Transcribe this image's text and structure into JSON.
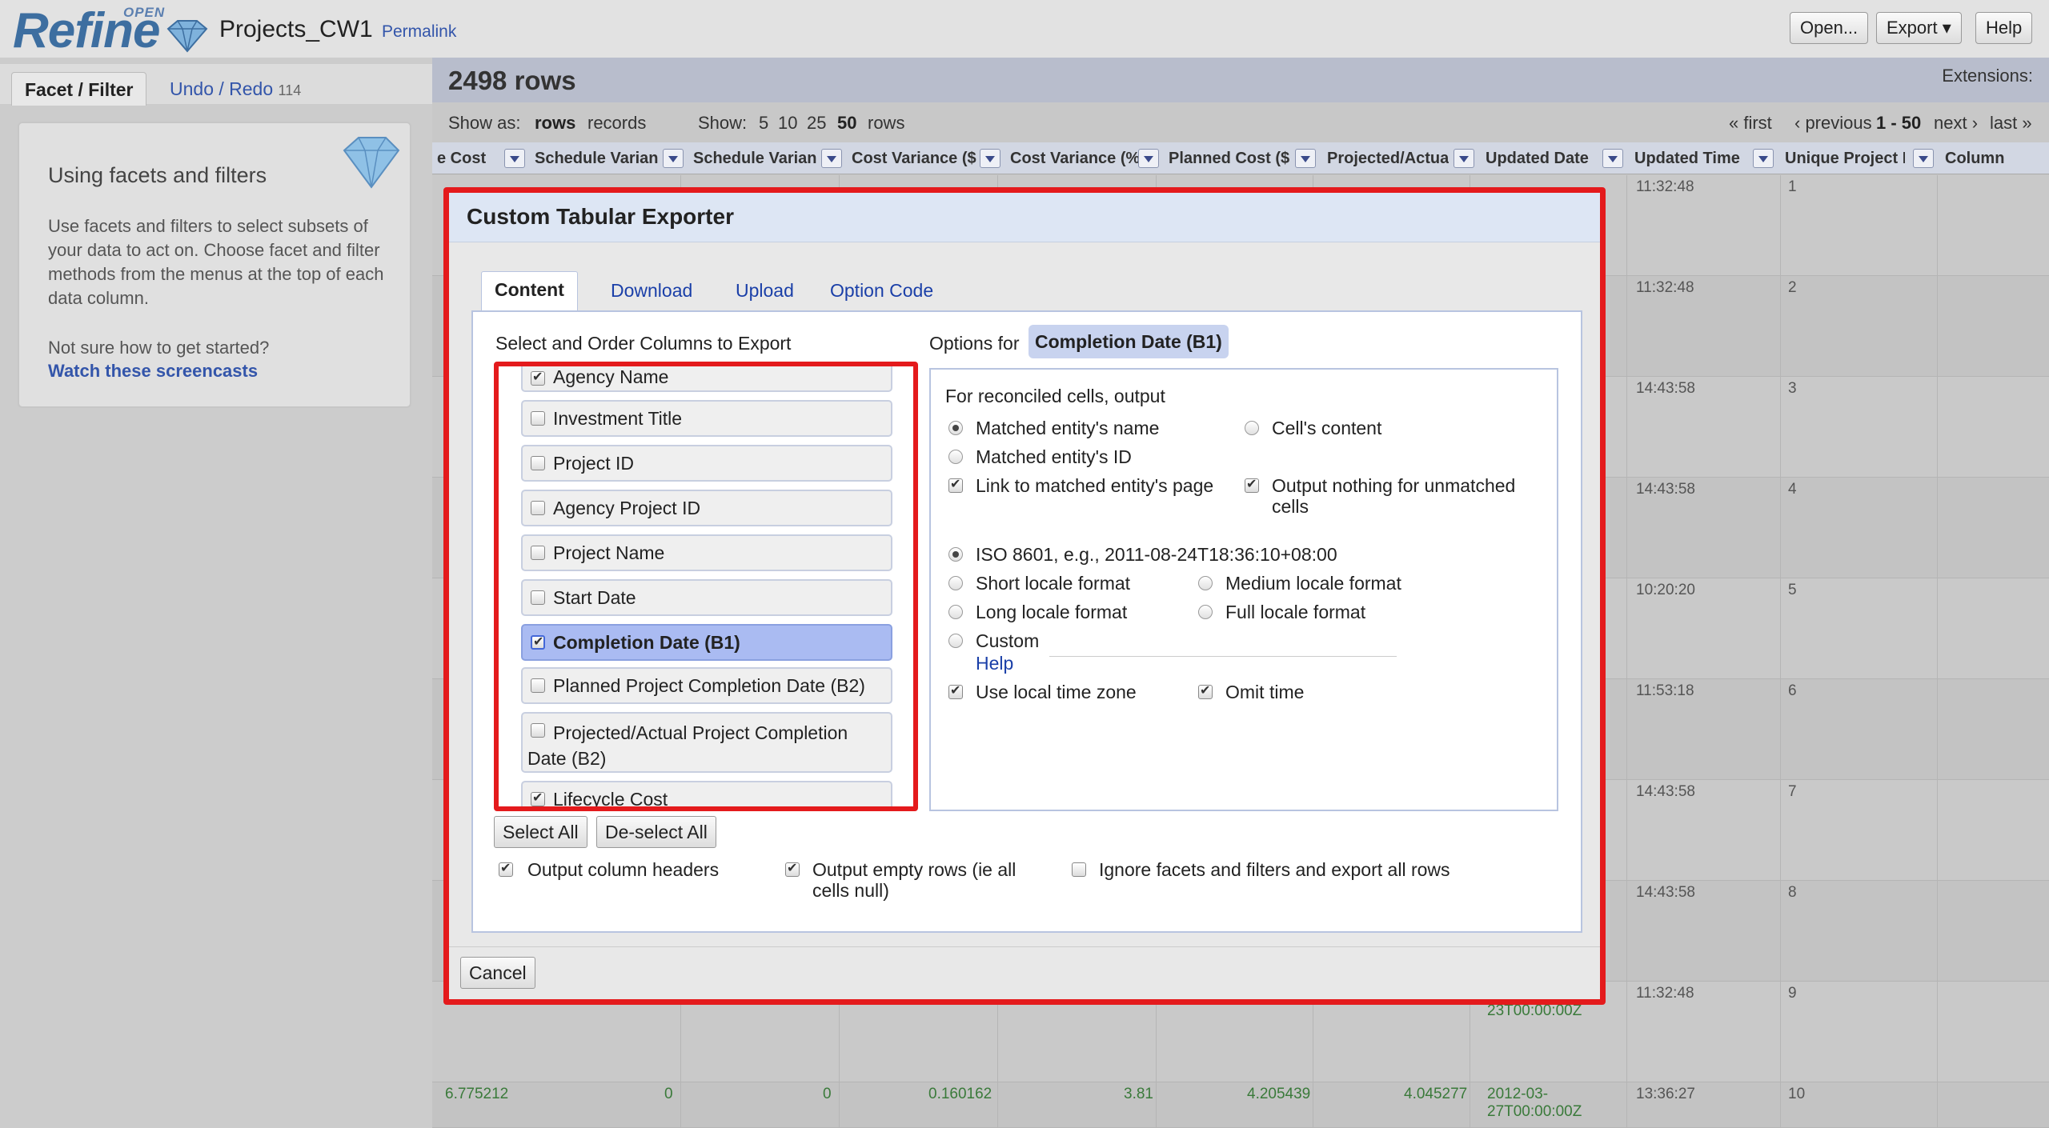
{
  "header": {
    "logo_open": "OPEN",
    "logo_refine": "Refine",
    "project_name": "Projects_CW1",
    "permalink": "Permalink",
    "buttons": {
      "open": "Open...",
      "export": "Export ▾",
      "help": "Help"
    }
  },
  "left": {
    "tabs": {
      "facet": "Facet / Filter",
      "undo": "Undo / Redo",
      "undo_count": "114"
    },
    "help": {
      "title": "Using facets and filters",
      "text": "Use facets and filters to select subsets of your data to act on. Choose facet and filter methods from the menus at the top of each data column.",
      "question": "Not sure how to get started?",
      "link": "Watch these screencasts"
    }
  },
  "grid": {
    "rows_count": "2498 rows",
    "extensions": "Extensions:",
    "show_as_label": "Show as:",
    "show_as_rows": "rows",
    "show_as_records": "records",
    "show_label": "Show:",
    "show_sizes": [
      "5",
      "10",
      "25",
      "50"
    ],
    "show_rows_word": "rows",
    "pager": {
      "first": "« first",
      "previous": "‹ previous",
      "range": "1 - 50",
      "next": "next ›",
      "last": "last »"
    },
    "columns": [
      "e Cost",
      "Schedule Varian",
      "Schedule Varian",
      "Cost Variance ($",
      "Cost Variance (%",
      "Planned Cost ($",
      "Projected/Actua",
      "Updated Date",
      "Updated Time",
      "Unique Project I",
      "Column"
    ],
    "times": [
      "11:32:48",
      "11:32:48",
      "14:43:58",
      "14:43:58",
      "10:20:20",
      "11:53:18",
      "14:43:58",
      "14:43:58",
      "11:32:48",
      "13:36:27"
    ],
    "row_numbers": [
      "1",
      "2",
      "3",
      "4",
      "5",
      "6",
      "7",
      "8",
      "9",
      "10"
    ],
    "row9_date_tail": "23T00:00:00Z",
    "row10_values": [
      "6.775212",
      "0",
      "0",
      "0.160162",
      "3.81",
      "4.205439",
      "4.045277"
    ],
    "row10_date": "2012-03-",
    "row10_date_tail": "27T00:00:00Z"
  },
  "dialog": {
    "title": "Custom Tabular Exporter",
    "tabs": [
      "Content",
      "Download",
      "Upload",
      "Option Code"
    ],
    "select_label": "Select and Order Columns to Export",
    "options_for_label": "Options for",
    "options_for_column": "Completion Date (B1)",
    "columns": [
      {
        "label": "Agency Name",
        "checked": true
      },
      {
        "label": "Investment Title",
        "checked": false
      },
      {
        "label": "Project ID",
        "checked": false
      },
      {
        "label": "Agency Project ID",
        "checked": false
      },
      {
        "label": "Project Name",
        "checked": false
      },
      {
        "label": "Start Date",
        "checked": false
      },
      {
        "label": "Completion Date (B1)",
        "checked": true,
        "selected": true
      },
      {
        "label": "Planned Project Completion Date (B2)",
        "checked": false
      },
      {
        "label": "Projected/Actual Project Completion Date (B2)",
        "checked": false
      },
      {
        "label": "Lifecycle Cost",
        "checked": true
      }
    ],
    "select_all": "Select All",
    "deselect_all": "De-select All",
    "reconciled_label": "For reconciled cells, output",
    "opt_matched_name": "Matched entity's name",
    "opt_cells_content": "Cell's content",
    "opt_matched_id": "Matched entity's ID",
    "opt_link_page": "Link to matched entity's page",
    "opt_output_nothing": "Output nothing for unmatched cells",
    "opt_iso": "ISO 8601, e.g., 2011-08-24T18:36:10+08:00",
    "opt_short_locale": "Short locale format",
    "opt_medium_locale": "Medium locale format",
    "opt_long_locale": "Long locale format",
    "opt_full_locale": "Full locale format",
    "opt_custom": "Custom",
    "opt_help": "Help",
    "opt_local_tz": "Use local time zone",
    "opt_omit_time": "Omit time",
    "bottom_headers": "Output column headers",
    "bottom_empty_rows": "Output empty rows (ie all cells null)",
    "bottom_ignore_facets": "Ignore facets and filters and export all rows",
    "cancel": "Cancel"
  }
}
